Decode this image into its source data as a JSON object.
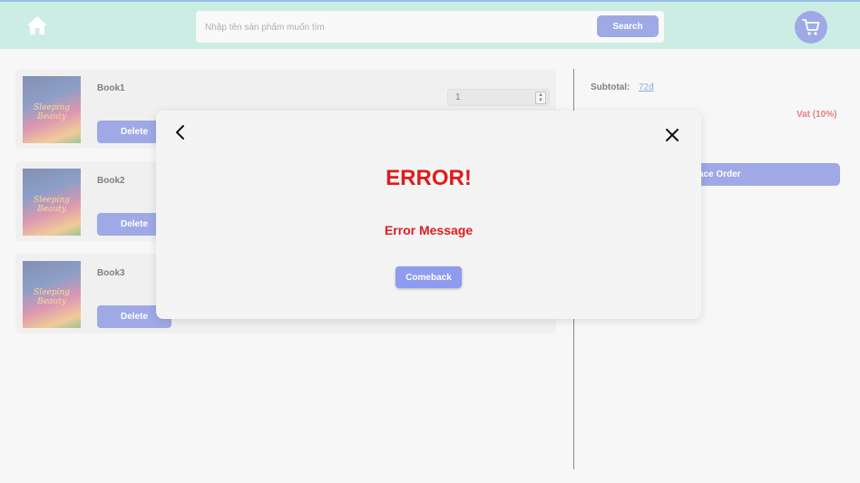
{
  "header": {
    "search": {
      "placeholder": "Nhập tên sản phẩm muốn tìm",
      "button_label": "Search"
    },
    "icons": {
      "home": "home-icon",
      "cart": "cart-icon"
    }
  },
  "cart": {
    "items": [
      {
        "name": "Book1",
        "quantity": "1",
        "delete_label": "Delete",
        "cover_title": "Sleeping Beauty"
      },
      {
        "name": "Book2",
        "delete_label": "Delete",
        "cover_title": "Sleeping Beauty"
      },
      {
        "name": "Book3",
        "delete_label": "Delete",
        "cover_title": "Sleeping Beauty"
      }
    ]
  },
  "summary": {
    "subtotal_label": "Subtotal:",
    "subtotal_value": "72đ",
    "vat_label": "Vat (10%)",
    "place_order_label": "Place Order"
  },
  "modal": {
    "title": "ERROR!",
    "message": "Error Message",
    "comeback_label": "Comeback",
    "icons": {
      "back": "chevron-left-icon",
      "close": "close-icon"
    }
  },
  "colors": {
    "header_bg": "#a8e0d0",
    "accent": "#5a6bd4",
    "error": "#e01b1b",
    "link": "#3b6fd1"
  }
}
